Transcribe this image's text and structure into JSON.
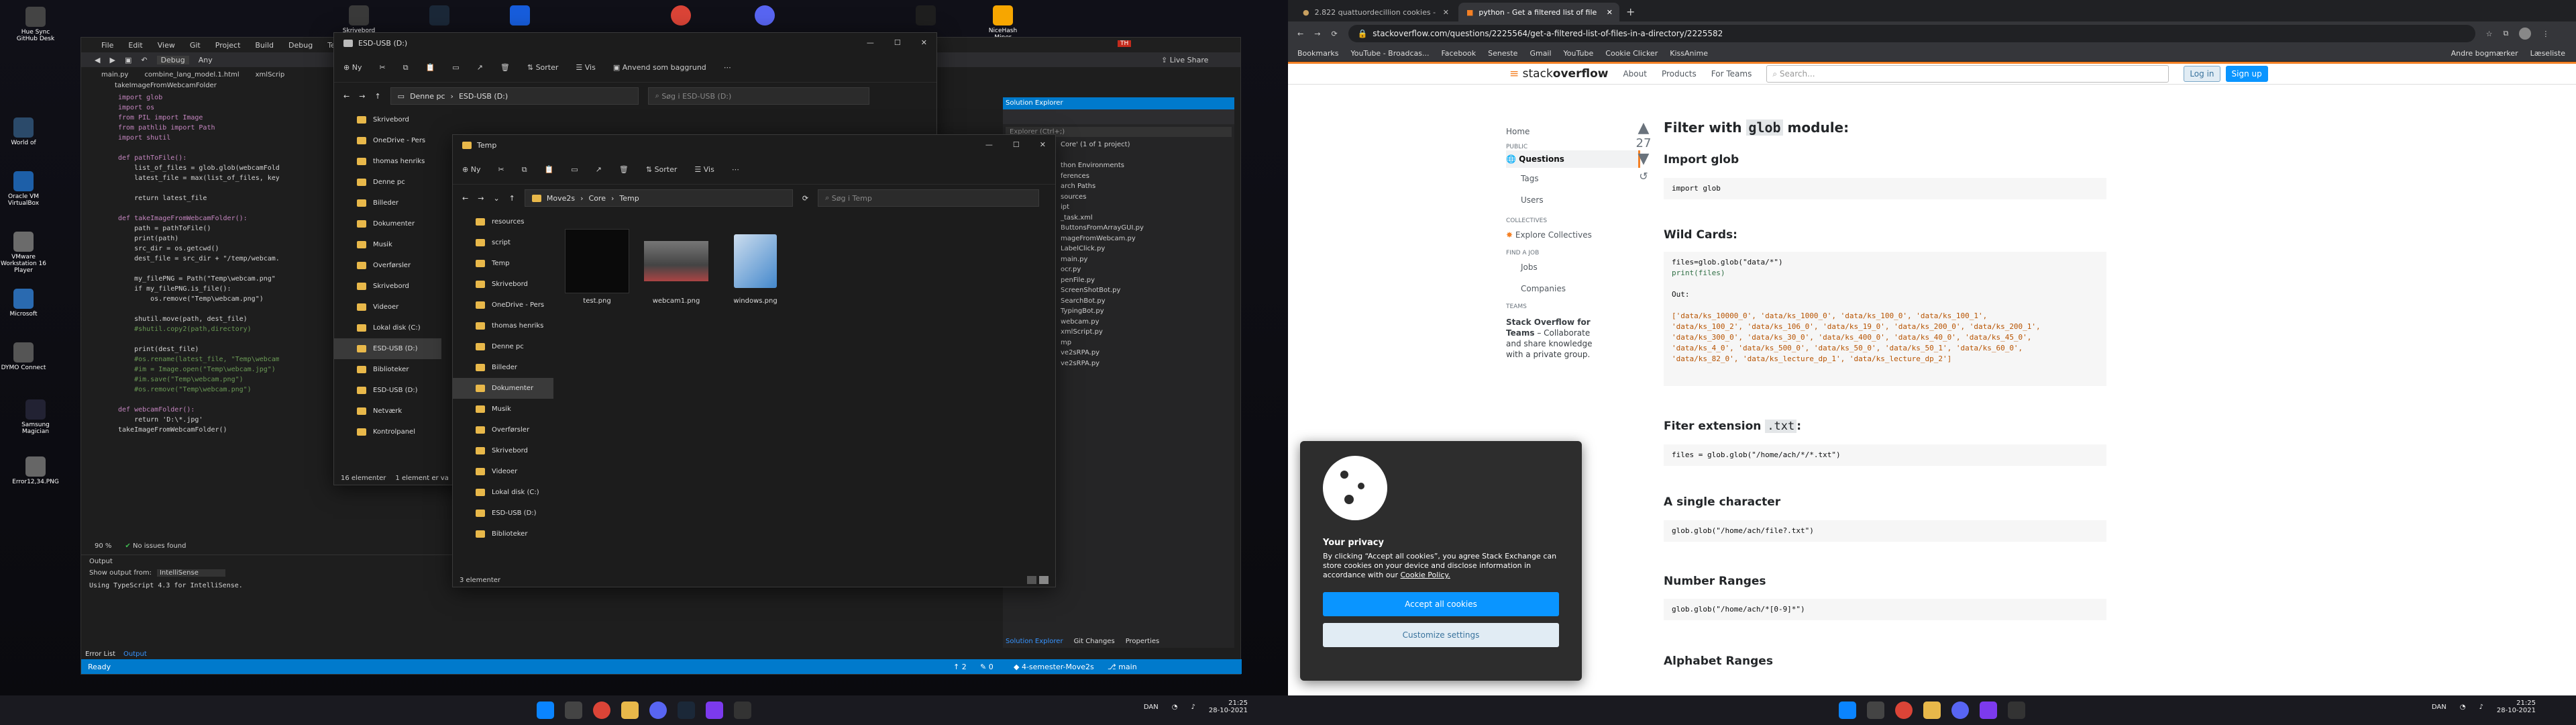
{
  "desktop": {
    "icons": [
      {
        "label": "Hue Sync",
        "sub": "GitHub Desk"
      },
      {
        "label": "World of"
      },
      {
        "label": "Oracle VM VirtualBox"
      },
      {
        "label": "VMware Workstation 16 Player"
      },
      {
        "label": "Microsoft"
      },
      {
        "label": "DYMO Connect"
      },
      {
        "label": "Samsung Magician"
      },
      {
        "label": "Error12,34.PNG"
      }
    ],
    "top_icons": [
      {
        "label": "Skrivebord"
      },
      {
        "label": "Steam"
      },
      {
        "label": "Bitwarden"
      },
      {
        "label": "Chrome"
      },
      {
        "label": "Discord"
      },
      {
        "label": "Razer Cortex"
      },
      {
        "label": "NiceHash Miner"
      }
    ]
  },
  "vs": {
    "menu": [
      "File",
      "Edit",
      "View",
      "Git",
      "Project",
      "Build",
      "Debug",
      "Te"
    ],
    "debug_label": "Debug",
    "any_label": "Any",
    "tabs": [
      "main.py",
      "combine_lang_model.1.html",
      "xmlScrip"
    ],
    "breadcrumb": "takeImageFromWebcamFolder",
    "code_lines": [
      {
        "t": "import glob",
        "k": "import"
      },
      {
        "t": "import os",
        "k": "import"
      },
      {
        "t": "from PIL import Image",
        "k": "from"
      },
      {
        "t": "from pathlib import Path",
        "k": "from"
      },
      {
        "t": "import shutil",
        "k": "import"
      },
      {
        "t": ""
      },
      {
        "t": "def pathToFile():",
        "k": "def"
      },
      {
        "t": "    list_of_files = glob.glob(webcamFold"
      },
      {
        "t": "    latest_file = max(list_of_files, key"
      },
      {
        "t": ""
      },
      {
        "t": "    return latest_file"
      },
      {
        "t": ""
      },
      {
        "t": "def takeImageFromWebcamFolder():",
        "k": "def"
      },
      {
        "t": "    path = pathToFile()"
      },
      {
        "t": "    print(path)"
      },
      {
        "t": "    src_dir = os.getcwd()"
      },
      {
        "t": "    dest_file = src_dir + \"/temp/webcam."
      },
      {
        "t": ""
      },
      {
        "t": "    my_filePNG = Path(\"Temp\\webcam.png\""
      },
      {
        "t": "    if my_filePNG.is_file():"
      },
      {
        "t": "        os.remove(\"Temp\\webcam.png\")"
      },
      {
        "t": ""
      },
      {
        "t": "    shutil.move(path, dest_file)"
      },
      {
        "t": "    #shutil.copy2(path,directory)",
        "c": true
      },
      {
        "t": ""
      },
      {
        "t": "    print(dest_file)"
      },
      {
        "t": "    #os.rename(latest_file, \"Temp\\webcam",
        "c": true
      },
      {
        "t": "    #im = Image.open(\"Temp\\webcam.jpg\")",
        "c": true
      },
      {
        "t": "    #im.save(\"Temp\\webcam.png\")",
        "c": true
      },
      {
        "t": "    #os.remove(\"Temp\\webcam.png\")",
        "c": true
      },
      {
        "t": ""
      },
      {
        "t": "def webcamFolder():",
        "k": "def"
      },
      {
        "t": "    return 'D:\\*.jpg'"
      },
      {
        "t": "takeImageFromWebcamFolder()"
      }
    ],
    "zoom": "90 %",
    "issues": "No issues found",
    "output_title": "Output",
    "output_from_label": "Show output from:",
    "output_from_value": "IntelliSense",
    "output_text": "Using TypeScript 4.3 for IntelliSense.",
    "bottom_tabs": [
      "Error List",
      "Output"
    ],
    "status_ready": "Ready",
    "status_branch": "main",
    "status_repo": "4-semester-Move2s",
    "status_errors": "0",
    "status_up": "2",
    "live_share": "Live Share",
    "user_initials": "TH",
    "solex_title": "Solution Explorer",
    "solex_search": "Explorer (Ctrl+;)",
    "solex_items": [
      "Core' (1 of 1 project)",
      "",
      "thon Environments",
      "ferences",
      "arch Paths",
      "sources",
      "ipt",
      "_task.xml",
      "ButtonsFromArrayGUI.py",
      "mageFromWebcam.py",
      "LabelClick.py",
      "main.py",
      "ocr.py",
      "penFile.py",
      "ScreenShotBot.py",
      "SearchBot.py",
      "TypingBot.py",
      "webcam.py",
      "xmlScript.py",
      "mp",
      "ve2sRPA.py",
      "ve2sRPA.py"
    ],
    "solex_bottom_tabs": [
      "Solution Explorer",
      "Git Changes",
      "Properties"
    ]
  },
  "explorer_back": {
    "title": "ESD-USB (D:)",
    "new": "Ny",
    "sort": "Sorter",
    "view": "Vis",
    "apply": "Anvend som baggrund",
    "path": "Denne pc",
    "path2": "ESD-USB (D:)",
    "search": "Søg i ESD-USB (D:)",
    "nav": [
      "Skrivebord",
      "OneDrive - Pers",
      "thomas henriks",
      "Denne pc",
      "Billeder",
      "Dokumenter",
      "Musik",
      "Overførsler",
      "Skrivebord",
      "Videoer",
      "Lokal disk (C:)",
      "ESD-USB (D:)",
      "Biblioteker",
      "ESD-USB (D:)",
      "Netværk",
      "Kontrolpanel"
    ],
    "status_count": "16 elementer",
    "status_sel": "1 element er va"
  },
  "explorer_front": {
    "title": "Temp",
    "new": "Ny",
    "sort": "Sorter",
    "view": "Vis",
    "path": [
      "Move2s",
      "Core",
      "Temp"
    ],
    "search": "Søg i Temp",
    "nav": [
      "resources",
      "script",
      "Temp",
      "Skrivebord",
      "OneDrive - Pers",
      "thomas henriks",
      "Denne pc",
      "Billeder",
      "Dokumenter",
      "Musik",
      "Overførsler",
      "Skrivebord",
      "Videoer",
      "Lokal disk (C:)",
      "ESD-USB (D:)",
      "Biblioteker"
    ],
    "files": [
      {
        "name": "test.png"
      },
      {
        "name": "webcam1.png"
      },
      {
        "name": "windows.png"
      }
    ],
    "status": "3 elementer"
  },
  "taskbar_left": {
    "lang": "DAN",
    "time": "21:25",
    "date": "28-10-2021"
  },
  "browser": {
    "tabs": [
      {
        "title": "2.822 quattuordecillion cookies -"
      },
      {
        "title": "python - Get a filtered list of file"
      }
    ],
    "url": "stackoverflow.com/questions/2225564/get-a-filtered-list-of-files-in-a-directory/2225582",
    "bookmarks": [
      "Bookmarks",
      "YouTube - Broadcas...",
      "Facebook",
      "Seneste",
      "Gmail",
      "YouTube",
      "Cookie Clicker",
      "KissAnime"
    ],
    "other_bookmarks": "Andre bogmærker",
    "reading_list": "Læseliste",
    "so": {
      "logo_a": "stack",
      "logo_b": "overflow",
      "nav": [
        "About",
        "Products",
        "For Teams"
      ],
      "search_placeholder": "Search...",
      "login": "Log in",
      "signup": "Sign up",
      "side": {
        "home": "Home",
        "public": "PUBLIC",
        "questions": "Questions",
        "tags": "Tags",
        "users": "Users",
        "collectives": "COLLECTIVES",
        "explore": "Explore Collectives",
        "find_job": "FIND A JOB",
        "jobs": "Jobs",
        "companies": "Companies",
        "teams": "TEAMS",
        "teams_text1": "Stack Overflow for Teams",
        "teams_text2": "– Collaborate and share knowledge with a private group."
      },
      "votes": "27",
      "h_filter": "Filter with ",
      "h_filter_code": "glob",
      "h_filter_rest": " module:",
      "h_import": "Import glob",
      "c_import": "import glob",
      "h_wild": "Wild Cards:",
      "c_wild1": "files=glob.glob(\"data/*\")",
      "c_wild2": "print(files)",
      "c_wild3": "Out:",
      "c_wild4": "['data/ks_10000_0', 'data/ks_1000_0', 'data/ks_100_0', 'data/ks_100_1',",
      "c_wild5": "'data/ks_100_2', 'data/ks_106_0', 'data/ks_19_0', 'data/ks_200_0', 'data/ks_200_1',",
      "c_wild6": "'data/ks_300_0', 'data/ks_30_0', 'data/ks_400_0', 'data/ks_40_0', 'data/ks_45_0',",
      "c_wild7": "'data/ks_4_0', 'data/ks_500_0', 'data/ks_50_0', 'data/ks_50_1', 'data/ks_60_0',",
      "c_wild8": "'data/ks_82_0', 'data/ks_lecture_dp_1', 'data/ks_lecture_dp_2']",
      "h_ext": "Fiter extension ",
      "h_ext_code": ".txt",
      "h_ext_rest": ":",
      "c_ext": "files = glob.glob(\"/home/ach/*/*.txt\")",
      "h_single": "A single character",
      "c_single": "glob.glob(\"/home/ach/file?.txt\")",
      "h_num": "Number Ranges",
      "c_num": "glob.glob(\"/home/ach/*[0-9]*\")",
      "h_alpha": "Alphabet Ranges"
    },
    "cookie": {
      "title": "Your privacy",
      "text": "By clicking “Accept all cookies”, you agree Stack Exchange can store cookies on your device and disclose information in accordance with our ",
      "link": "Cookie Policy.",
      "accept": "Accept all cookies",
      "customize": "Customize settings"
    }
  },
  "taskbar_right": {
    "lang": "DAN",
    "time": "21:25",
    "date": "28-10-2021"
  },
  "colors": {
    "vs_blue": "#007acc",
    "so_orange": "#f48024",
    "so_blue": "#0a95ff",
    "folder": "#e8b84a"
  }
}
